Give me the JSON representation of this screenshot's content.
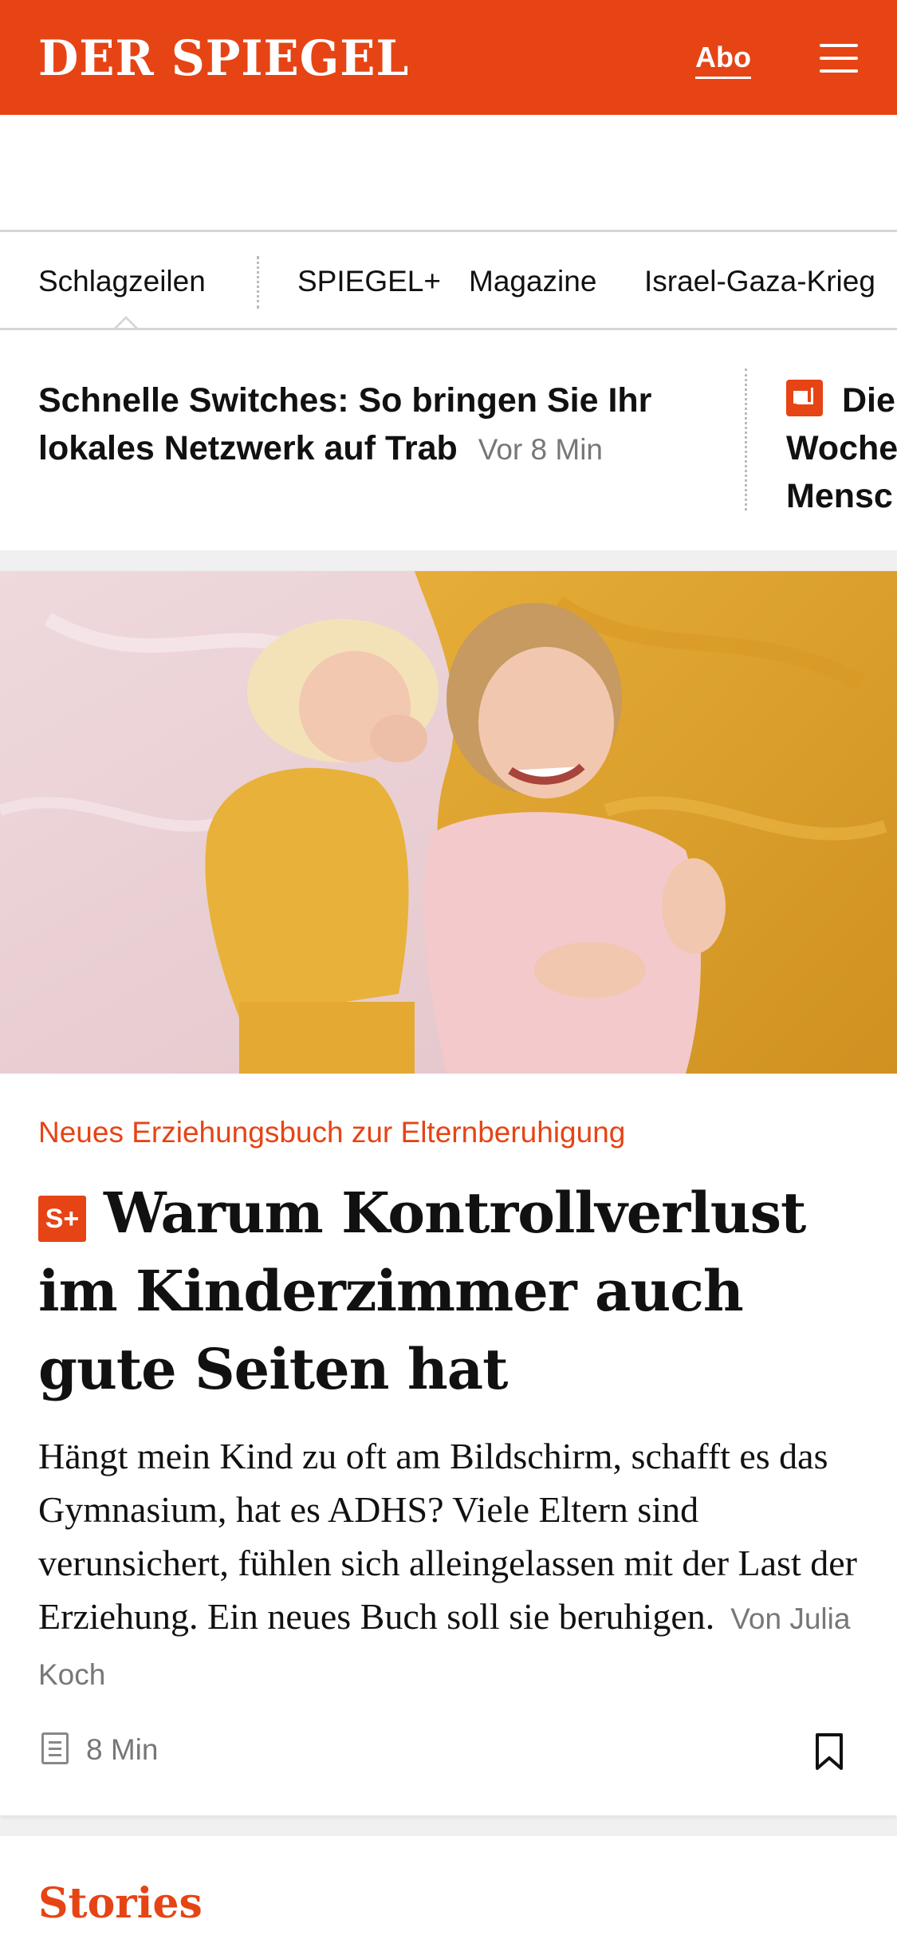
{
  "header": {
    "logo": "DER SPIEGEL",
    "abo_label": "Abo",
    "brand_color": "#e64415"
  },
  "nav": {
    "items": [
      {
        "label": "Schlagzeilen",
        "active": true
      },
      {
        "label": "SPIEGEL+"
      },
      {
        "label": "Magazine"
      },
      {
        "label": "Israel-Gaza-Krieg"
      }
    ]
  },
  "ticker": {
    "headline": "Schnelle Switches: So bringen Sie Ihr lokales Netzwerk auf Trab",
    "time": "Vor 8 Min",
    "second_headline_visible": "Die Woche Mensc"
  },
  "article": {
    "kicker": "Neues Erziehungsbuch zur Elternberuhigung",
    "badge": "S+",
    "title": "Warum Kontrollverlust im Kinderzimmer auch gute Seiten hat",
    "teaser": "Hängt mein Kind zu oft am Bildschirm, schafft es das Gymnasium, hat es ADHS? Viele Eltern sind verunsichert, fühlen sich alleingelassen mit der Last der Erziehung. Ein neues Buch soll sie beruhigen.",
    "author": "Von Julia Koch",
    "read_time": "8 Min",
    "icons": {
      "read_time": "document-icon",
      "save": "bookmark-icon"
    }
  },
  "stories": {
    "title": "Stories"
  }
}
